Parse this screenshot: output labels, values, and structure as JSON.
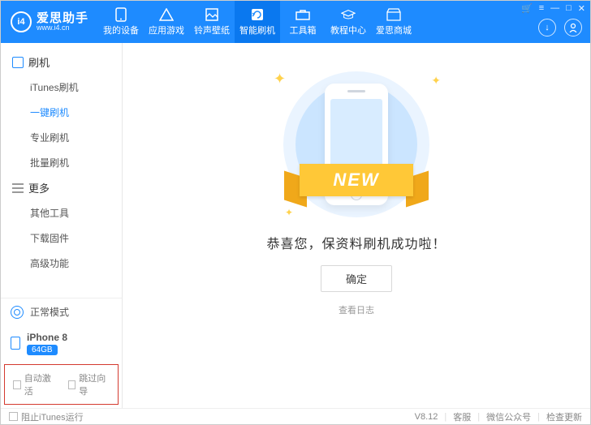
{
  "app": {
    "name": "爱思助手",
    "url": "www.i4.cn"
  },
  "nav": [
    {
      "label": "我的设备"
    },
    {
      "label": "应用游戏"
    },
    {
      "label": "铃声壁纸"
    },
    {
      "label": "智能刷机"
    },
    {
      "label": "工具箱"
    },
    {
      "label": "教程中心"
    },
    {
      "label": "爱思商城"
    }
  ],
  "sidebar": {
    "group1": {
      "title": "刷机",
      "items": [
        "iTunes刷机",
        "一键刷机",
        "专业刷机",
        "批量刷机"
      ]
    },
    "group2": {
      "title": "更多",
      "items": [
        "其他工具",
        "下载固件",
        "高级功能"
      ]
    },
    "mode": "正常模式",
    "device": {
      "name": "iPhone 8",
      "storage": "64GB"
    },
    "options": {
      "auto_activate": "自动激活",
      "skip_guide": "跳过向导"
    }
  },
  "main": {
    "ribbon": "NEW",
    "success": "恭喜您，保资料刷机成功啦！",
    "ok": "确定",
    "view_log": "查看日志"
  },
  "footer": {
    "block_itunes": "阻止iTunes运行",
    "version": "V8.12",
    "support": "客服",
    "wechat": "微信公众号",
    "check_update": "检查更新"
  }
}
